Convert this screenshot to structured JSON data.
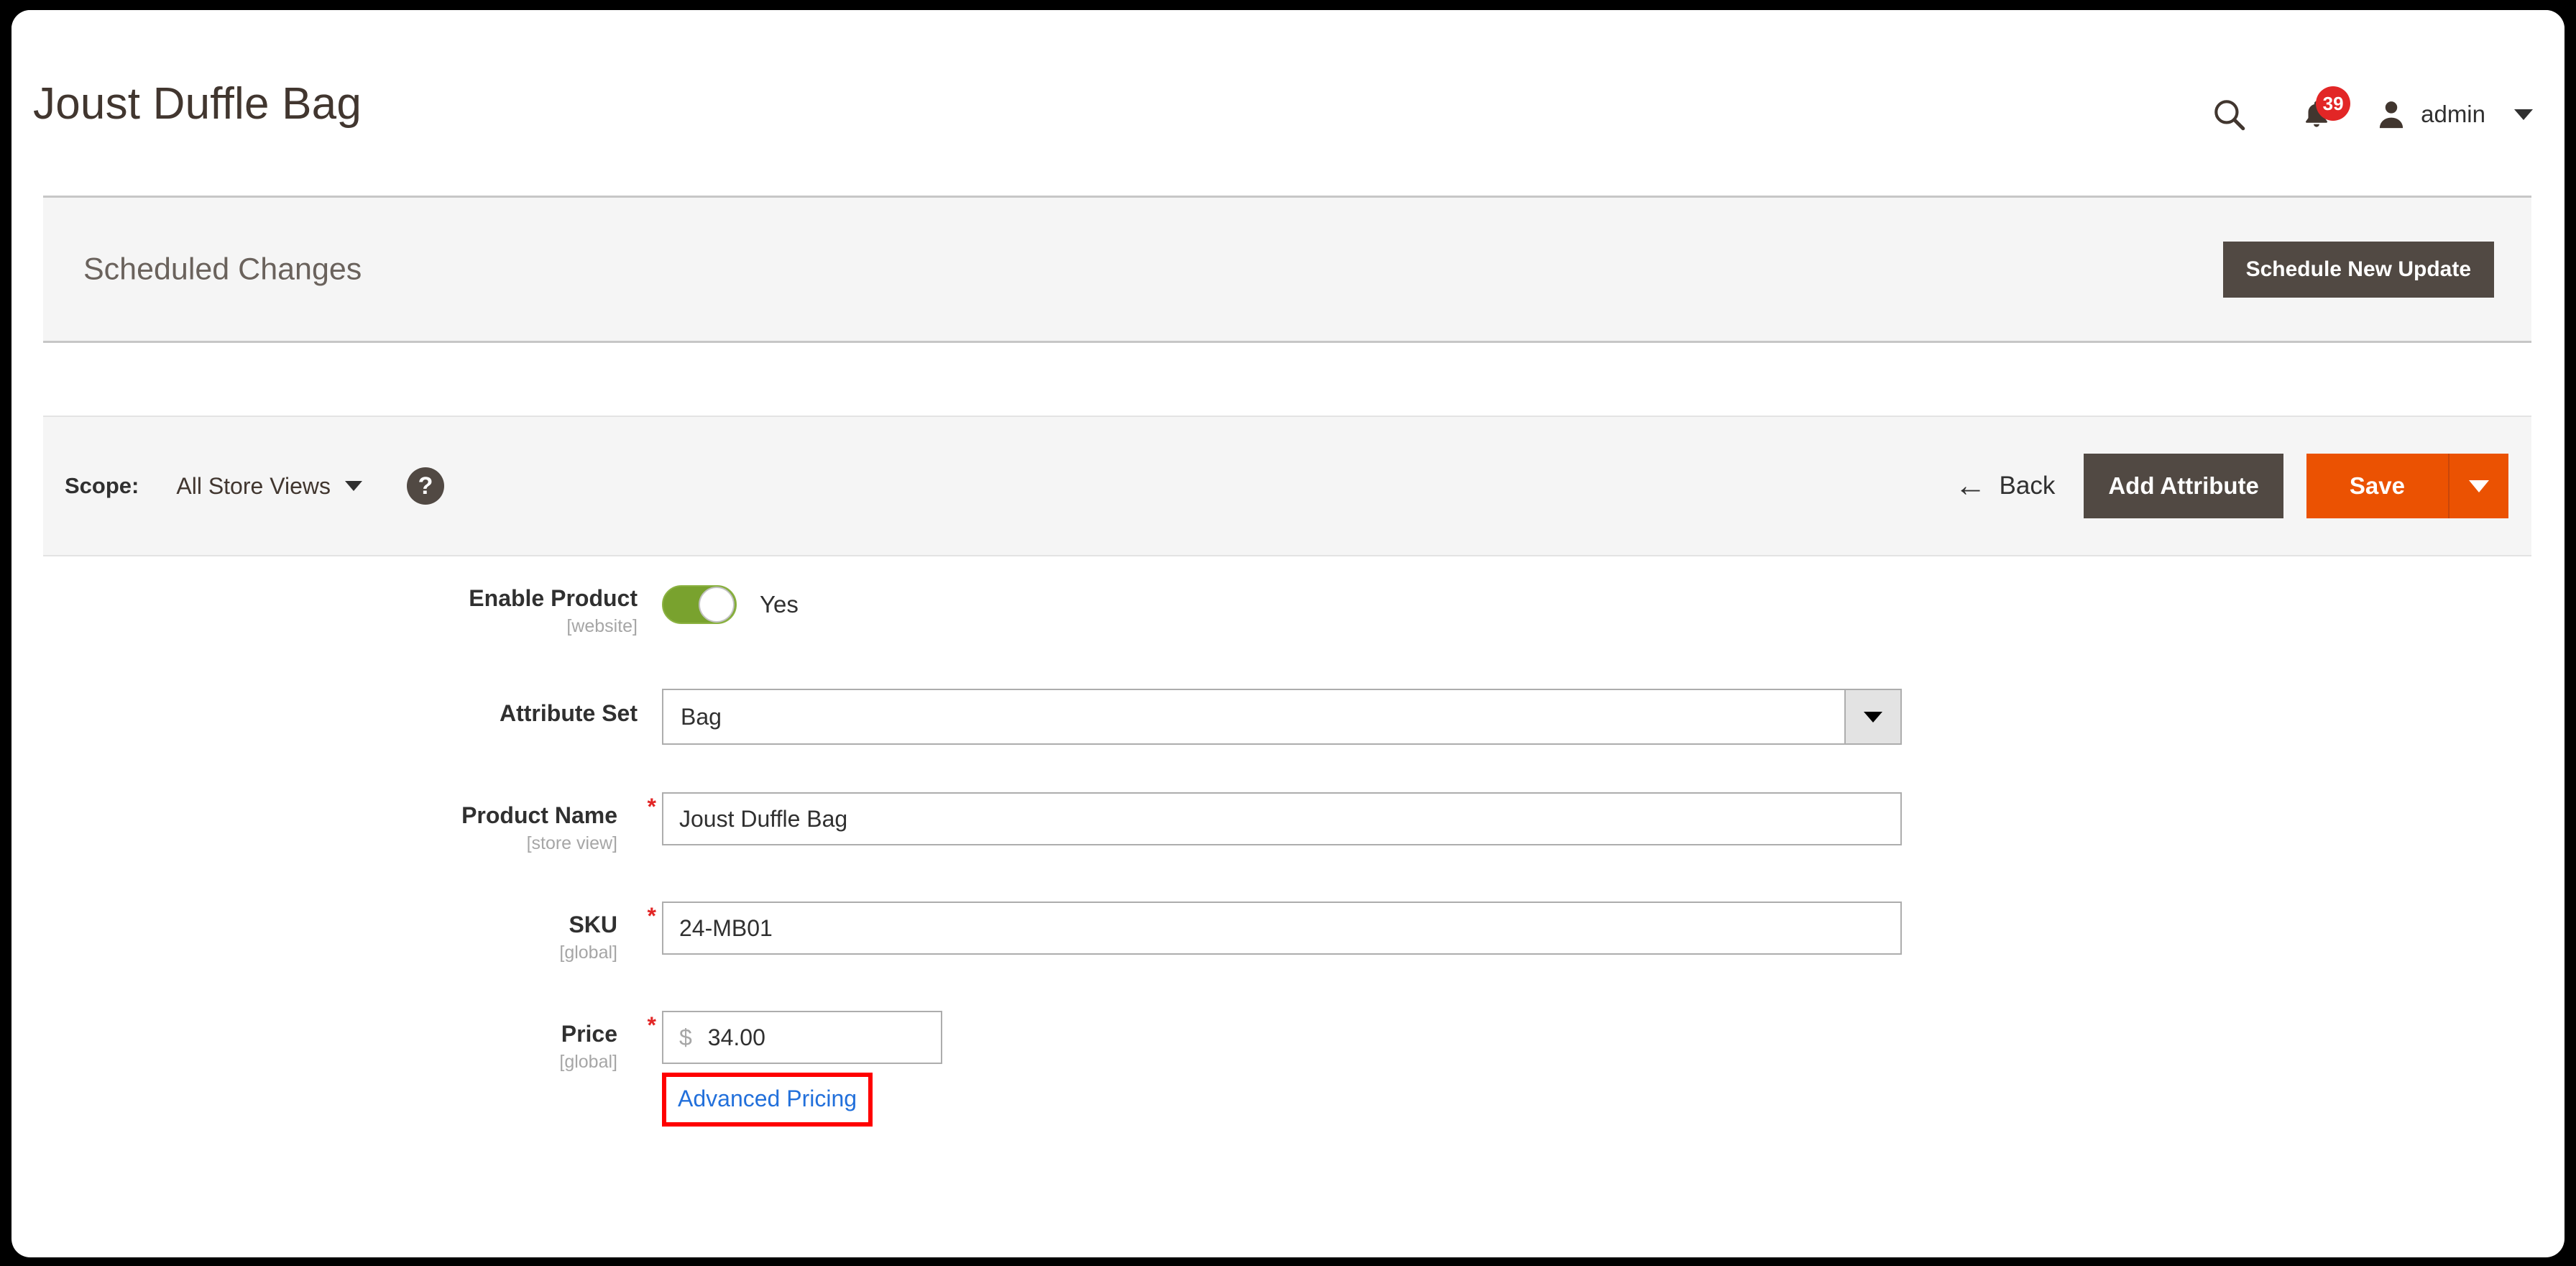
{
  "header": {
    "page_title": "Joust Duffle Bag",
    "search_icon": "search-icon",
    "notifications_icon": "bell-icon",
    "notifications_count": "39",
    "user_icon": "user-avatar-icon",
    "user_name": "admin",
    "user_caret_icon": "chevron-down-icon",
    "badge_color": "#e22626"
  },
  "scheduled_changes": {
    "title": "Scheduled Changes",
    "button_label": "Schedule New Update",
    "button_color": "#514943"
  },
  "page_actions": {
    "scope_label": "Scope:",
    "scope_value": "All Store Views",
    "scope_caret_icon": "chevron-down-icon",
    "help_icon": "question-mark-icon",
    "help_glyph": "?",
    "back_arrow_glyph": "←",
    "back_label": "Back",
    "add_attribute_label": "Add Attribute",
    "save_label": "Save",
    "save_caret_icon": "chevron-down-icon",
    "save_color": "#eb5202",
    "add_attribute_color": "#514943"
  },
  "form": {
    "enable_product": {
      "label": "Enable Product",
      "scope": "[website]",
      "toggle_state": "Yes",
      "toggle_on_color": "#79a22e"
    },
    "attribute_set": {
      "label": "Attribute Set",
      "value": "Bag",
      "caret_icon": "chevron-down-icon"
    },
    "product_name": {
      "label": "Product Name",
      "required_mark": "*",
      "scope": "[store view]",
      "value": "Joust Duffle Bag"
    },
    "sku": {
      "label": "SKU",
      "required_mark": "*",
      "scope": "[global]",
      "value": "24-MB01"
    },
    "price": {
      "label": "Price",
      "required_mark": "*",
      "scope": "[global]",
      "currency": "$",
      "value": "34.00",
      "advanced_pricing_label": "Advanced Pricing",
      "highlight_color": "#ff0000"
    }
  }
}
